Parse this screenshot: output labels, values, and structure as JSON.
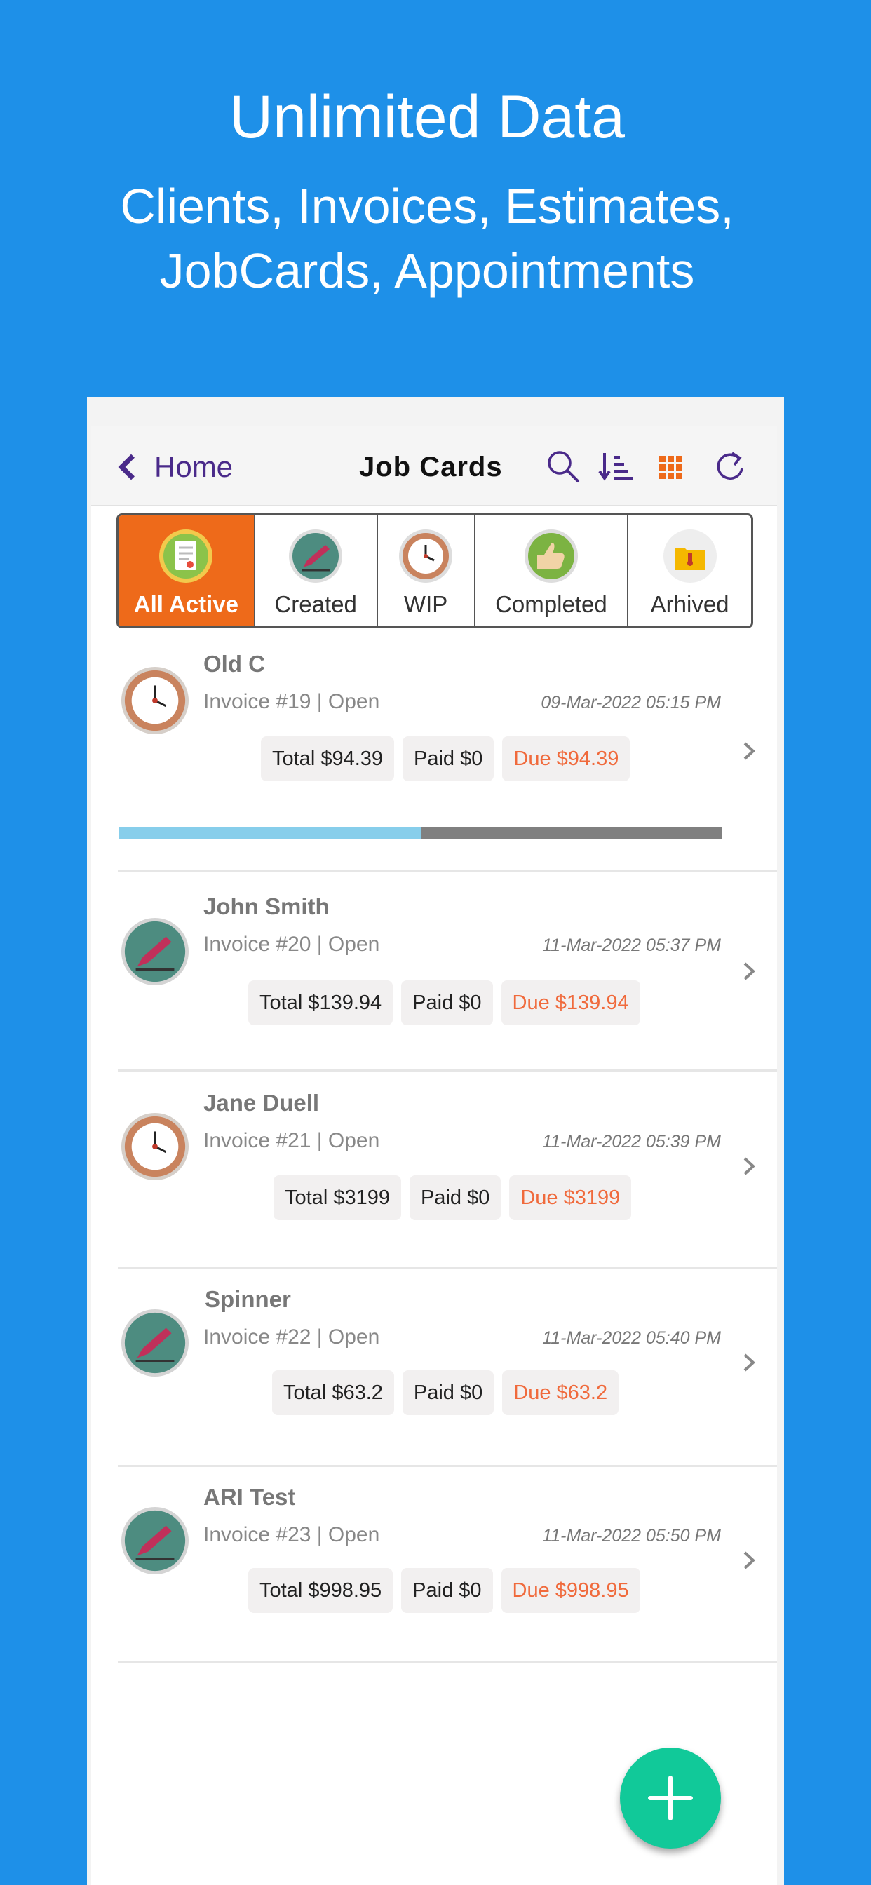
{
  "promo": {
    "title": "Unlimited Data",
    "subtitle_line1": "Clients, Invoices, Estimates,",
    "subtitle_line2": "JobCards, Appointments"
  },
  "header": {
    "back_label": "Home",
    "title": "Job Cards",
    "icons": [
      "search-icon",
      "sort-icon",
      "grid-icon",
      "refresh-icon"
    ]
  },
  "tabs": [
    {
      "label": "All Active",
      "icon": "checklist-icon",
      "active": true
    },
    {
      "label": "Created",
      "icon": "pencil-icon",
      "active": false
    },
    {
      "label": "WIP",
      "icon": "clock-icon",
      "active": false
    },
    {
      "label": "Completed",
      "icon": "thumbs-up-icon",
      "active": false
    },
    {
      "label": "Arhived",
      "icon": "archive-folder-icon",
      "active": false
    }
  ],
  "jobs": [
    {
      "name": "Old C",
      "invoice": "Invoice #19 | Open",
      "date": "09-Mar-2022 05:15 PM",
      "total": "Total $94.39",
      "paid": "Paid $0",
      "due": "Due $94.39",
      "icon": "clock-icon",
      "progress": 0.5
    },
    {
      "name": "John Smith",
      "invoice": "Invoice #20 | Open",
      "date": "11-Mar-2022 05:37 PM",
      "total": "Total $139.94",
      "paid": "Paid $0",
      "due": "Due $139.94",
      "icon": "pencil-icon"
    },
    {
      "name": "Jane Duell",
      "invoice": "Invoice #21 | Open",
      "date": "11-Mar-2022 05:39 PM",
      "total": "Total $3199",
      "paid": "Paid $0",
      "due": "Due $3199",
      "icon": "clock-icon"
    },
    {
      "name": "Spinner",
      "invoice": "Invoice #22 | Open",
      "date": "11-Mar-2022 05:40 PM",
      "total": "Total $63.2",
      "paid": "Paid $0",
      "due": "Due $63.2",
      "icon": "pencil-icon"
    },
    {
      "name": "ARI Test",
      "invoice": "Invoice #23 | Open",
      "date": "11-Mar-2022 05:50 PM",
      "total": "Total $998.95",
      "paid": "Paid $0",
      "due": "Due $998.95",
      "icon": "pencil-icon"
    }
  ],
  "colors": {
    "background": "#1e90e8",
    "accent_orange": "#ee6a1a",
    "due_text": "#f06a3c",
    "fab": "#11c999",
    "progress_fill": "#87ceeb",
    "progress_track": "#808080",
    "back_link": "#4a2a8a"
  }
}
